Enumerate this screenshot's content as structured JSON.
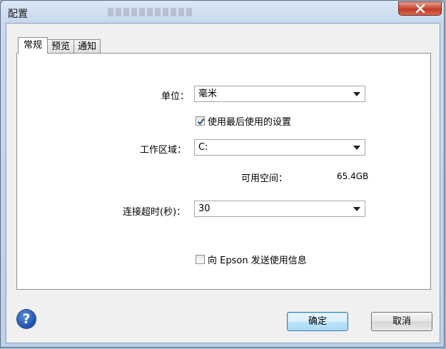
{
  "window": {
    "title": "配置"
  },
  "tabs": [
    {
      "label": "常规",
      "active": true
    },
    {
      "label": "预览",
      "active": false
    },
    {
      "label": "通知",
      "active": false
    }
  ],
  "general": {
    "unit_label": "单位：",
    "unit_value": "毫米",
    "use_last_settings_label": "使用最后使用的设置",
    "use_last_settings_checked": true,
    "workspace_label": "工作区域：",
    "workspace_value": "C:",
    "free_space_label": "可用空间：",
    "free_space_value": "65.4GB",
    "timeout_label": "连接超时(秒)：",
    "timeout_value": "30",
    "send_usage_label": "向 Epson 发送使用信息",
    "send_usage_checked": false
  },
  "buttons": {
    "ok": "确定",
    "cancel": "取消",
    "help": "?"
  },
  "colors": {
    "close_button": "#c13a25",
    "help_icon": "#1f4fa8",
    "default_button_border": "#3c7fb1"
  }
}
